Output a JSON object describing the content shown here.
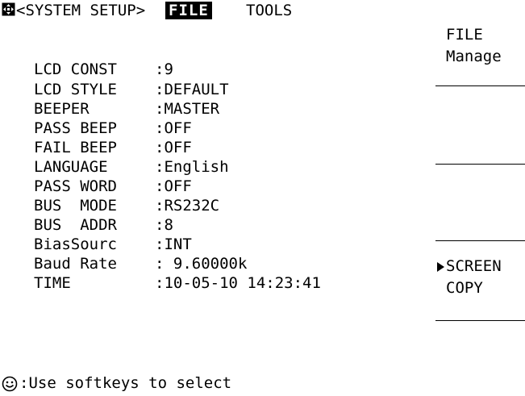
{
  "menu": {
    "system": "<SYSTEM SETUP>",
    "file": "FILE",
    "tools": "TOOLS"
  },
  "settings": [
    {
      "label": "LCD CONST",
      "sep": ":",
      "value": "9"
    },
    {
      "label": "LCD STYLE",
      "sep": ":",
      "value": "DEFAULT"
    },
    {
      "label": "BEEPER",
      "sep": ":",
      "value": "MASTER"
    },
    {
      "label": "PASS BEEP",
      "sep": ":",
      "value": "OFF"
    },
    {
      "label": "FAIL BEEP",
      "sep": ":",
      "value": "OFF"
    },
    {
      "label": "LANGUAGE",
      "sep": ":",
      "value": "English"
    },
    {
      "label": "PASS WORD",
      "sep": ":",
      "value": "OFF"
    },
    {
      "label": "BUS  MODE",
      "sep": ":",
      "value": "RS232C"
    },
    {
      "label": "BUS  ADDR",
      "sep": ":",
      "value": "8"
    },
    {
      "label": "BiasSourc",
      "sep": ":",
      "value": "INT"
    },
    {
      "label": "Baud Rate",
      "sep": ": ",
      "value": "9.60000k"
    },
    {
      "label": "TIME",
      "sep": ":",
      "value": "10-05-10 14:23:41"
    }
  ],
  "softkeys": {
    "file_manage": {
      "line1": "FILE",
      "line2": "Manage"
    },
    "screen_copy": {
      "line1": "SCREEN",
      "line2": "COPY"
    }
  },
  "status": {
    "text": ":Use softkeys to select"
  },
  "icons": {
    "menu": "keypad-icon",
    "status": "smiley-icon",
    "selected": "triangle-right-icon"
  }
}
